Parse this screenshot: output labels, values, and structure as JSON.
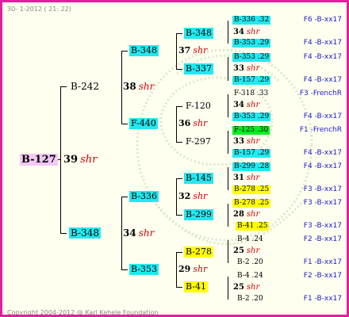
{
  "header": {
    "date": "30-  1-2012 ( 21: 22)"
  },
  "footer": {
    "copyright": "Copyright 2004-2012 @ Karl Kehele Foundation"
  },
  "root": {
    "id": "B-127",
    "mark": "39",
    "code": "shr"
  },
  "gen1": [
    {
      "id": "B-242",
      "mark": "38",
      "code": "shr"
    },
    {
      "id": "B-348",
      "mark": "34",
      "code": "shr"
    }
  ],
  "gen2": [
    {
      "id": "B-348",
      "mark": "37",
      "code": "shr"
    },
    {
      "id": "F-440",
      "mark": "36",
      "code": "shr"
    },
    {
      "id": "B-336",
      "mark": "32",
      "code": "shr"
    },
    {
      "id": "B-353",
      "mark": "29",
      "code": "shr"
    }
  ],
  "gen3": [
    {
      "id": "B-348",
      "mark": "34",
      "code": "shr"
    },
    {
      "id": "B-337",
      "mark": "33",
      "code": "shr"
    },
    {
      "id": "F-120",
      "mark": "34",
      "code": "shr"
    },
    {
      "id": "F-297",
      "mark": "33",
      "code": "shr"
    },
    {
      "id": "B-145",
      "mark": "31",
      "code": "shr"
    },
    {
      "id": "B-299",
      "mark": "28",
      "code": "shr"
    },
    {
      "id": "B-278",
      "mark": "25",
      "code": "shr"
    },
    {
      "id": "B-41",
      "mark": "25",
      "code": "shr"
    }
  ],
  "gen4": [
    {
      "id": "B-336 .32",
      "note": "F6 -B-xx17"
    },
    {
      "id": "B-353 .29",
      "note": "F4 -B-xx17"
    },
    {
      "id": "B-353 .29",
      "note": "F4 -B-xx17"
    },
    {
      "id": "B-157 .29",
      "note": "F4 -B-xx17"
    },
    {
      "id": "F-318 .33",
      "note": "F3 -FrenchR"
    },
    {
      "id": "B-353 .29",
      "note": "F4 -B-xx17"
    },
    {
      "id": "F-125 .30",
      "note": "F1 -FrenchR"
    },
    {
      "id": "B-157 .29",
      "note": "F4 -B-xx17"
    },
    {
      "id": "B-299 .28",
      "note": "F4 -B-xx17"
    },
    {
      "id": "B-278 .25",
      "note": "F3 -B-xx17"
    },
    {
      "id": "B-278 .25",
      "note": "F3 -B-xx17"
    },
    {
      "id": "B-41 .25",
      "note": "F3 -B-xx17"
    },
    {
      "id": "B-4 .24",
      "note": "F2 -B-xx17"
    },
    {
      "id": "B-2 .20",
      "note": "F1 -B-xx17"
    },
    {
      "id": "B-4 .24",
      "note": "F2 -B-xx17"
    },
    {
      "id": "B-2 .20",
      "note": "F1 -B-xx17"
    }
  ],
  "colors": {
    "frame": "#e0209f",
    "cyan": "#22e8f0",
    "yellow": "#ffff00",
    "green": "#00ee22",
    "pink": "#f4c8f4",
    "note_blue": "#1a1ac8",
    "shr_red": "#d00000"
  }
}
